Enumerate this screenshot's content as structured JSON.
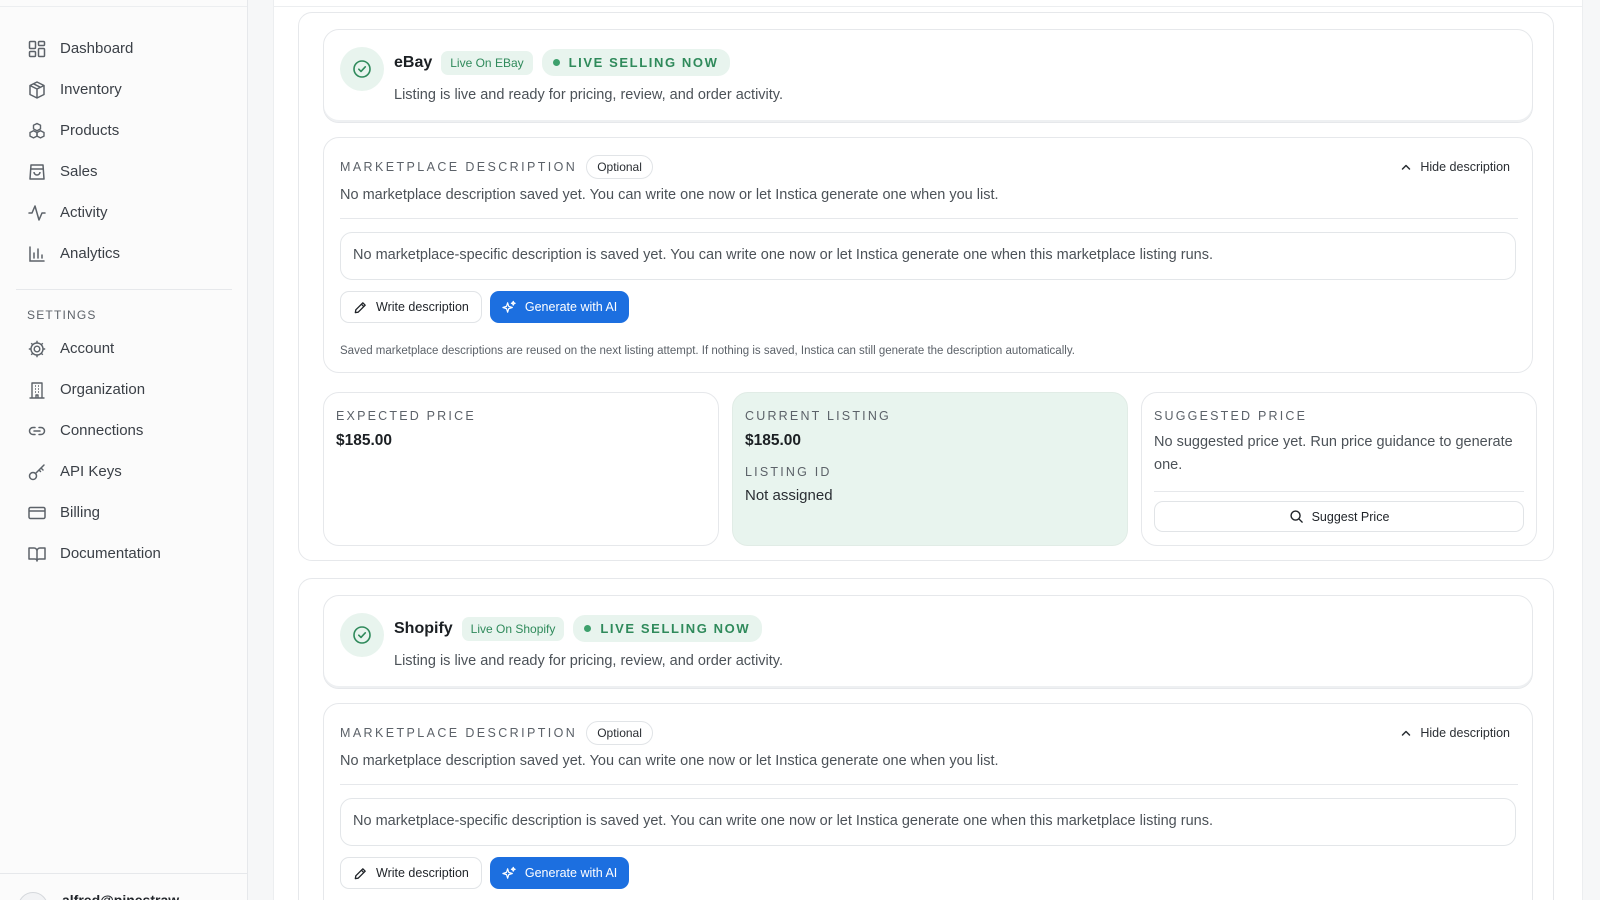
{
  "sidebar": {
    "nav": [
      {
        "label": "Dashboard",
        "icon": "dashboard-icon"
      },
      {
        "label": "Inventory",
        "icon": "package-icon"
      },
      {
        "label": "Products",
        "icon": "boxes-icon"
      },
      {
        "label": "Sales",
        "icon": "shopping-bag-icon"
      },
      {
        "label": "Activity",
        "icon": "activity-icon"
      },
      {
        "label": "Analytics",
        "icon": "bar-chart-icon"
      }
    ],
    "settings_heading": "SETTINGS",
    "settings": [
      {
        "label": "Account",
        "icon": "gear-icon"
      },
      {
        "label": "Organization",
        "icon": "building-icon"
      },
      {
        "label": "Connections",
        "icon": "link-icon"
      },
      {
        "label": "API Keys",
        "icon": "key-icon"
      },
      {
        "label": "Billing",
        "icon": "credit-card-icon"
      },
      {
        "label": "Documentation",
        "icon": "book-icon"
      }
    ],
    "user_email": "alfred@pinestraw"
  },
  "marketplaces": [
    {
      "name": "eBay",
      "live_badge": "Live On EBay",
      "selling_badge": "LIVE SELLING NOW",
      "status_text": "Listing is live and ready for pricing, review, and order activity.",
      "description": {
        "label": "MARKETPLACE DESCRIPTION",
        "optional_badge": "Optional",
        "hide_label": "Hide description",
        "info": "No marketplace description saved yet. You can write one now or let Instica generate one when you list.",
        "placeholder": "No marketplace-specific description is saved yet. You can write one now or let Instica generate one when this marketplace listing runs.",
        "write_label": "Write description",
        "generate_label": "Generate with AI",
        "note": "Saved marketplace descriptions are reused on the next listing attempt. If nothing is saved, Instica can still generate the description automatically."
      },
      "expected": {
        "label": "EXPECTED PRICE",
        "value": "$185.00"
      },
      "current": {
        "label": "CURRENT LISTING",
        "value": "$185.00",
        "id_label": "LISTING ID",
        "id_value": "Not assigned"
      },
      "suggested": {
        "label": "SUGGESTED PRICE",
        "text": "No suggested price yet. Run price guidance to generate one.",
        "button": "Suggest Price"
      }
    },
    {
      "name": "Shopify",
      "live_badge": "Live On Shopify",
      "selling_badge": "LIVE SELLING NOW",
      "status_text": "Listing is live and ready for pricing, review, and order activity.",
      "description": {
        "label": "MARKETPLACE DESCRIPTION",
        "optional_badge": "Optional",
        "hide_label": "Hide description",
        "info": "No marketplace description saved yet. You can write one now or let Instica generate one when you list.",
        "placeholder": "No marketplace-specific description is saved yet. You can write one now or let Instica generate one when this marketplace listing runs.",
        "write_label": "Write description",
        "generate_label": "Generate with AI"
      }
    }
  ],
  "colors": {
    "accent": "#1c6fe0",
    "success": "#2f8a5b",
    "success_bg": "#e8f4ee"
  }
}
